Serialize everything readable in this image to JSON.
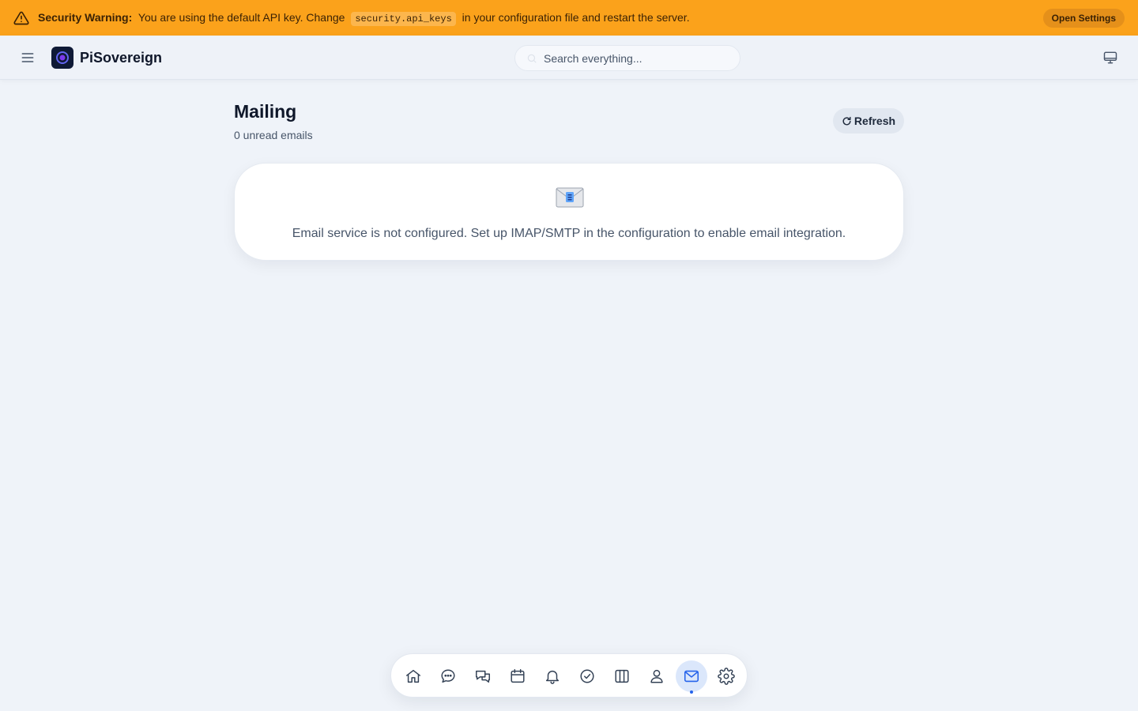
{
  "banner": {
    "label": "Security Warning:",
    "text_before": "You are using the default API key. Change",
    "code": "security.api_keys",
    "text_after": "in your configuration file and restart the server.",
    "button_label": "Open Settings",
    "color": "#fba21b"
  },
  "header": {
    "menu_icon": "hamburger-icon",
    "logo_icon": "ring-logo-icon",
    "brand": "PiSovereign",
    "search_placeholder": "Search everything...",
    "display_icon": "monitor-icon"
  },
  "main": {
    "title": "Mailing",
    "subtitle": "0 unread emails",
    "refresh_label": "Refresh",
    "empty_icon": "envelope-emoji-icon",
    "empty_message": "Email service is not configured. Set up IMAP/SMTP in the configuration to enable email integration."
  },
  "nav": {
    "items": [
      {
        "icon": "home-icon",
        "active": false
      },
      {
        "icon": "chat-bubble-icon",
        "active": false
      },
      {
        "icon": "conversations-icon",
        "active": false
      },
      {
        "icon": "calendar-icon",
        "active": false
      },
      {
        "icon": "bell-icon",
        "active": false
      },
      {
        "icon": "check-circle-icon",
        "active": false
      },
      {
        "icon": "kanban-columns-icon",
        "active": false
      },
      {
        "icon": "person-icon",
        "active": false
      },
      {
        "icon": "mail-icon",
        "active": true
      },
      {
        "icon": "gear-icon",
        "active": false
      }
    ],
    "accent_color": "#2563eb"
  }
}
